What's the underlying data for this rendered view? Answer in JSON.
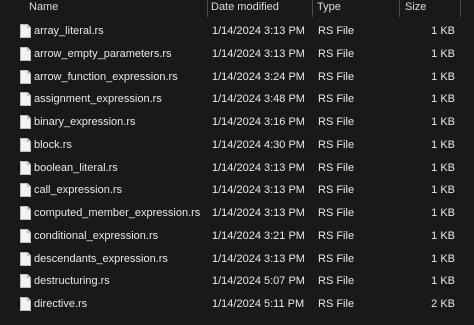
{
  "columns": {
    "name": "Name",
    "date_modified": "Date modified",
    "type": "Type",
    "size": "Size"
  },
  "files": [
    {
      "name": "array_literal.rs",
      "date": "1/14/2024 3:13 PM",
      "type": "RS File",
      "size": "1 KB",
      "icon": "file-icon"
    },
    {
      "name": "arrow_empty_parameters.rs",
      "date": "1/14/2024 3:13 PM",
      "type": "RS File",
      "size": "1 KB",
      "icon": "file-icon"
    },
    {
      "name": "arrow_function_expression.rs",
      "date": "1/14/2024 3:24 PM",
      "type": "RS File",
      "size": "1 KB",
      "icon": "file-icon"
    },
    {
      "name": "assignment_expression.rs",
      "date": "1/14/2024 3:48 PM",
      "type": "RS File",
      "size": "1 KB",
      "icon": "file-icon"
    },
    {
      "name": "binary_expression.rs",
      "date": "1/14/2024 3:16 PM",
      "type": "RS File",
      "size": "1 KB",
      "icon": "file-icon"
    },
    {
      "name": "block.rs",
      "date": "1/14/2024 4:30 PM",
      "type": "RS File",
      "size": "1 KB",
      "icon": "file-icon"
    },
    {
      "name": "boolean_literal.rs",
      "date": "1/14/2024 3:13 PM",
      "type": "RS File",
      "size": "1 KB",
      "icon": "file-icon"
    },
    {
      "name": "call_expression.rs",
      "date": "1/14/2024 3:13 PM",
      "type": "RS File",
      "size": "1 KB",
      "icon": "file-icon"
    },
    {
      "name": "computed_member_expression.rs",
      "date": "1/14/2024 3:13 PM",
      "type": "RS File",
      "size": "1 KB",
      "icon": "file-icon"
    },
    {
      "name": "conditional_expression.rs",
      "date": "1/14/2024 3:21 PM",
      "type": "RS File",
      "size": "1 KB",
      "icon": "file-icon"
    },
    {
      "name": "descendants_expression.rs",
      "date": "1/14/2024 3:13 PM",
      "type": "RS File",
      "size": "1 KB",
      "icon": "file-icon"
    },
    {
      "name": "destructuring.rs",
      "date": "1/14/2024 5:07 PM",
      "type": "RS File",
      "size": "1 KB",
      "icon": "file-icon"
    },
    {
      "name": "directive.rs",
      "date": "1/14/2024 5:11 PM",
      "type": "RS File",
      "size": "2 KB",
      "icon": "file-icon"
    }
  ]
}
